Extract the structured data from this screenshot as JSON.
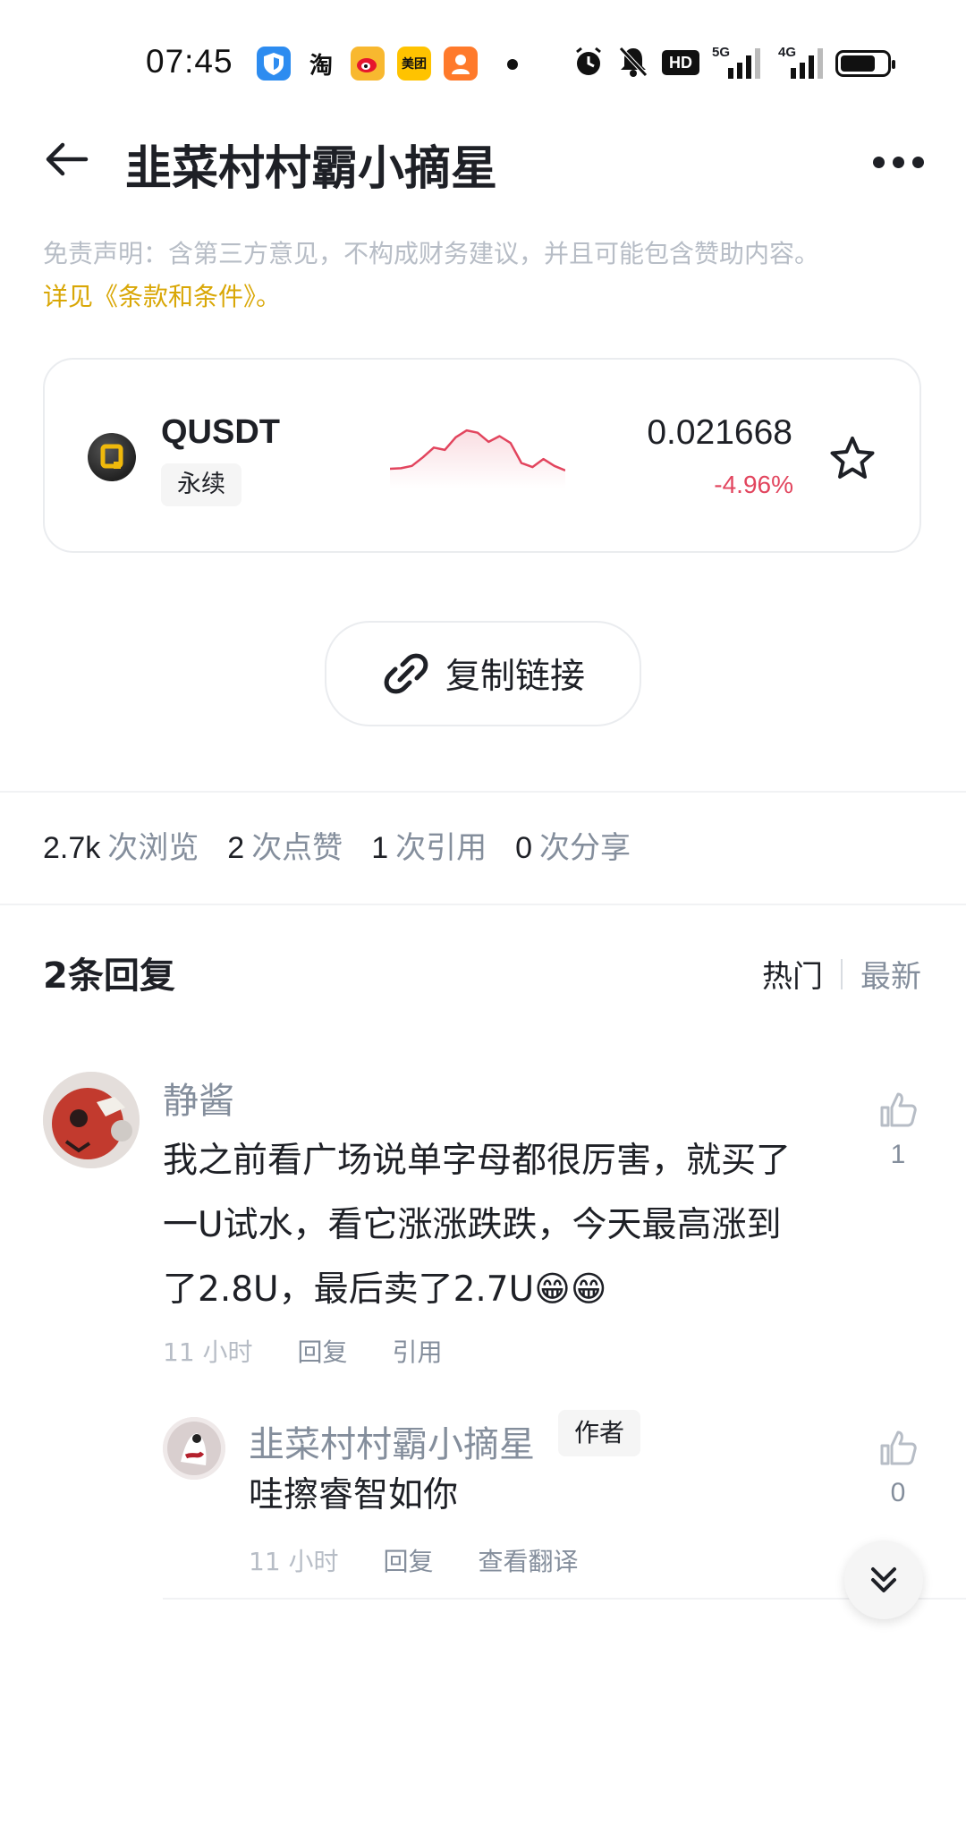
{
  "status_bar": {
    "time": "07:45",
    "apps": [
      {
        "name": "antivirus-app-icon",
        "color": "#2d8cf0",
        "glyph": "⛉"
      },
      {
        "name": "taobao-app-icon",
        "color": "#ffffff",
        "glyph": "淘"
      },
      {
        "name": "weibo-app-icon",
        "color": "#f8b82f",
        "glyph": "◉"
      },
      {
        "name": "meituan-app-icon",
        "color": "#ffc300",
        "glyph": "美团"
      },
      {
        "name": "app-icon-orange",
        "color": "#ff7a2b",
        "glyph": "☺"
      }
    ],
    "network_labels": {
      "hd": "HD",
      "sim1": "5G",
      "sim2": "4G"
    }
  },
  "header": {
    "title": "韭菜村村霸小摘星"
  },
  "disclaimer": {
    "text": "免责声明：含第三方意见，不构成财务建议，并且可能包含赞助内容。",
    "link": "详见《条款和条件》。"
  },
  "coin_card": {
    "symbol": "QUSDT",
    "tag": "永续",
    "price": "0.021668",
    "change": "-4.96%",
    "change_color": "#e2455e",
    "sparkline": [
      0.25,
      0.26,
      0.3,
      0.45,
      0.62,
      0.58,
      0.8,
      0.92,
      0.88,
      0.72,
      0.82,
      0.7,
      0.35,
      0.28,
      0.42,
      0.3,
      0.22
    ]
  },
  "copy_link": {
    "label": "复制链接"
  },
  "stats": [
    {
      "num": "2.7k",
      "label": "次浏览"
    },
    {
      "num": "2",
      "label": "次点赞"
    },
    {
      "num": "1",
      "label": "次引用"
    },
    {
      "num": "0",
      "label": "次分享"
    }
  ],
  "replies": {
    "count_label": "2条回复",
    "sort_hot": "热门",
    "sort_new": "最新"
  },
  "comments": [
    {
      "name": "静酱",
      "lines": [
        "我之前看广场说单字母都很厉害，就买了",
        "一U试水，看它涨涨跌跌，今天最高涨到",
        "了2.8U，最后卖了2.7U😁😁"
      ],
      "time": "11 小时",
      "reply": "回复",
      "quote": "引用",
      "likes": "1"
    },
    {
      "name": "韭菜村村霸小摘星",
      "badge": "作者",
      "text": "哇擦睿智如你",
      "time": "11 小时",
      "reply": "回复",
      "translate": "查看翻译",
      "likes": "0"
    }
  ]
}
